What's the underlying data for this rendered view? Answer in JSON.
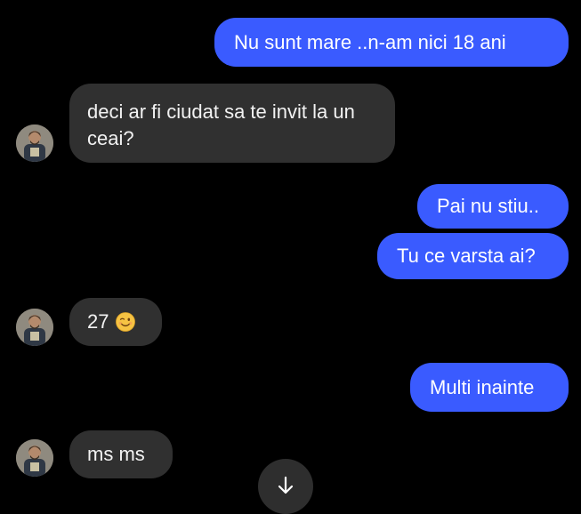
{
  "messages": [
    {
      "text": "Nu sunt mare ..n-am nici 18 ani"
    },
    {
      "text": "deci ar fi ciudat sa te invit la un ceai?"
    },
    {
      "text": "Pai nu stiu.."
    },
    {
      "text": "Tu ce varsta ai?"
    },
    {
      "text": "27",
      "emoji": "winking-face-emoji"
    },
    {
      "text": "Multi inainte"
    },
    {
      "text": "ms ms"
    }
  ],
  "icons": {
    "avatar": "profile-photo",
    "scroll_down": "arrow-down-icon"
  },
  "colors": {
    "background": "#000000",
    "outgoing_bubble": "#3a5bff",
    "incoming_bubble": "#303030",
    "text": "#ffffff"
  }
}
